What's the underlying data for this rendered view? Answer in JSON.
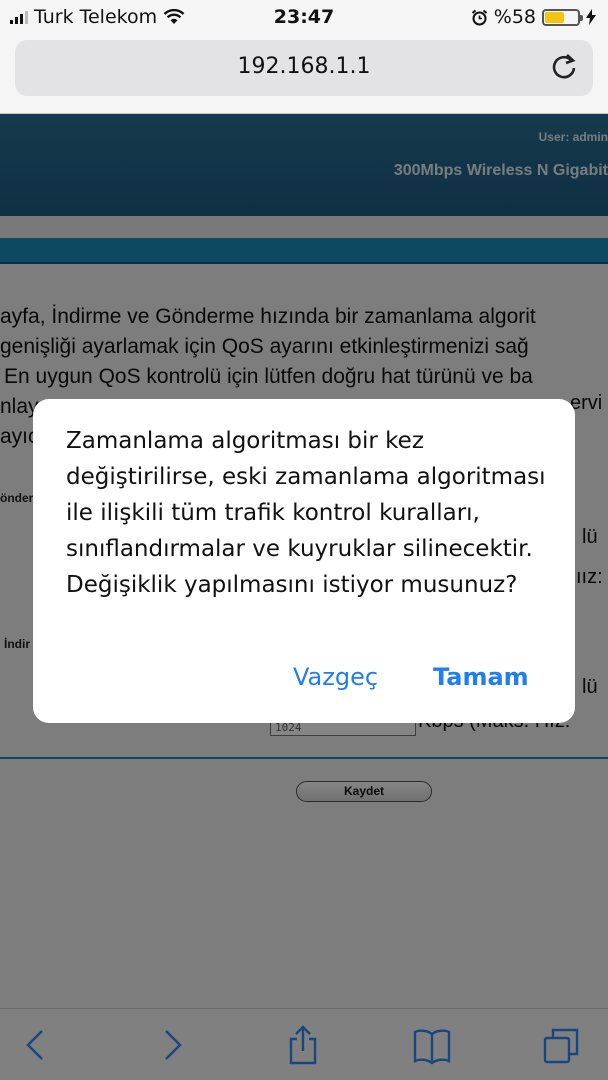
{
  "status_bar": {
    "carrier": "Turk Telekom",
    "time": "23:47",
    "battery_percent": "%58",
    "battery_level": 0.58,
    "icons": [
      "signal-icon",
      "wifi-icon",
      "alarm-icon",
      "battery-icon",
      "charging-bolt-icon"
    ]
  },
  "address_bar": {
    "url": "192.168.1.1",
    "reload_icon": "reload-icon"
  },
  "router_page": {
    "user_label": "User:  admin",
    "model_title": "300Mbps Wireless N Gigabit",
    "intro_lines": [
      "ayfa, İndirme ve Gönderme hızında bir zamanlama algorit",
      " genişliği ayarlamak için QoS ayarını etkinleştirmenizi sağ",
      "En uygun QoS kontrolü için lütfen doğru hat türünü ve ba",
      "nlay",
      "ayıc"
    ],
    "intro_right_fragment": "ervi",
    "section_label_upload": "önder",
    "section_label_download": "İndir",
    "row_suffix_1": "lü",
    "row_suffix_2": "ıız:",
    "row_suffix_3": "lü",
    "bandwidth_input_value": "1024",
    "bandwidth_unit_text": "Kbps (Maks. Hız:",
    "save_button": "Kaydet"
  },
  "dialog": {
    "message": "Zamanlama algoritması bir kez değiştirilirse, eski zamanlama algoritması ile ilişkili tüm trafik kontrol kuralları, sınıflandırmalar ve kuyruklar silinecektir. Değişiklik yapılmasını istiyor musunuz?",
    "cancel_label": "Vazgeç",
    "ok_label": "Tamam"
  },
  "toolbar": {
    "icons": [
      "back-icon",
      "forward-icon",
      "share-icon",
      "bookmarks-icon",
      "tabs-icon"
    ]
  },
  "colors": {
    "ios_blue": "#1f7ef2",
    "router_header_blue": "#1d5b80",
    "router_nav_blue": "#1b8cbc",
    "battery_yellow": "#f3c412"
  }
}
